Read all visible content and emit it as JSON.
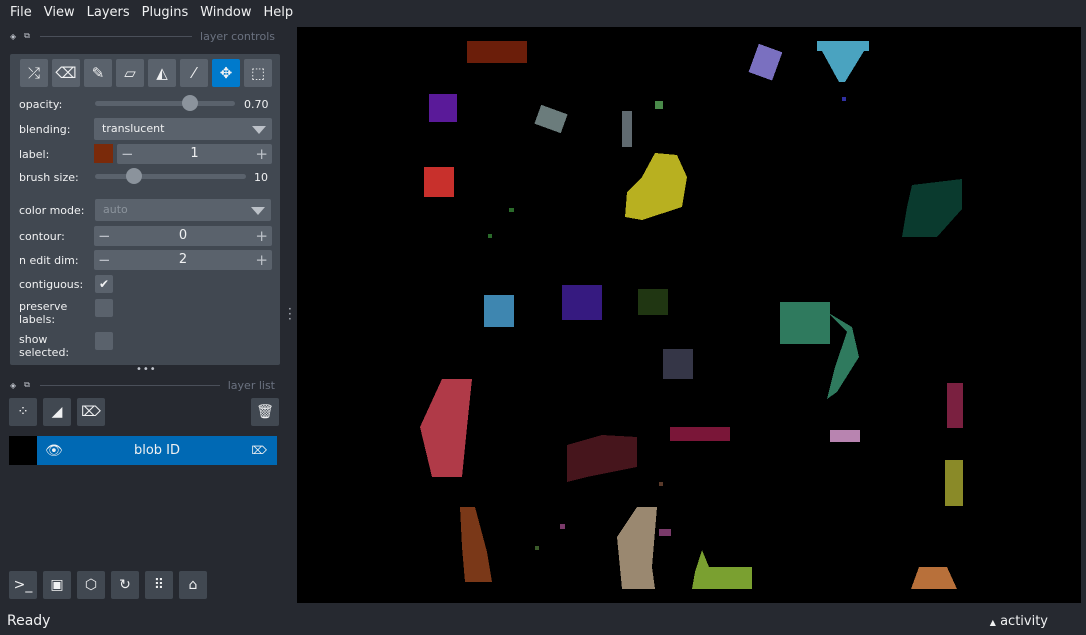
{
  "menu": [
    "File",
    "View",
    "Layers",
    "Plugins",
    "Window",
    "Help"
  ],
  "layer_controls": {
    "title": "layer controls",
    "tools": [
      "shuffle-icon",
      "eraser-icon",
      "paintbrush-icon",
      "polygon-icon",
      "fill-bucket-icon",
      "color-picker-icon",
      "move-icon",
      "select-icon"
    ],
    "active_tool": "move-icon",
    "opacity_label": "opacity:",
    "opacity_value": "0.70",
    "opacity": 0.7,
    "blending_label": "blending:",
    "blending_value": "translucent",
    "label_label": "label:",
    "label_value": "1",
    "label_color": "#7a2a0a",
    "brush_label": "brush size:",
    "brush_value": "10",
    "brush": 10,
    "color_mode_label": "color mode:",
    "color_mode_value": "auto",
    "contour_label": "contour:",
    "contour_value": "0",
    "ndim_label": "n edit dim:",
    "ndim_value": "2",
    "contiguous_label": "contiguous:",
    "contiguous": true,
    "preserve_label": "preserve labels:",
    "preserve": false,
    "show_selected_label": "show selected:",
    "show_selected": false
  },
  "layer_list": {
    "title": "layer list",
    "layers": [
      {
        "name": "blob ID",
        "visible": true
      }
    ]
  },
  "status": {
    "text": "Ready",
    "activity": "activity"
  },
  "accent": "#007acc"
}
